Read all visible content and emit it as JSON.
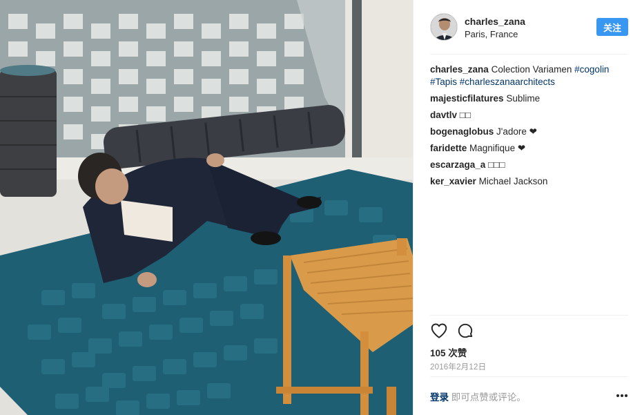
{
  "post": {
    "username": "charles_zana",
    "location": "Paris, France",
    "follow_label": "关注",
    "caption": {
      "user": "charles_zana",
      "text": "Colection Variamen",
      "tags": [
        "#cogolin",
        "#Tapis",
        "#charleszanaarchitects"
      ]
    },
    "comments": [
      {
        "user": "majesticfilatures",
        "text": "Sublime"
      },
      {
        "user": "davtlv",
        "text": "□□"
      },
      {
        "user": "bogenaglobus",
        "text": "J'adore ❤"
      },
      {
        "user": "faridette",
        "text": "Magnifique ❤"
      },
      {
        "user": "escarzaga_a",
        "text": "□□□"
      },
      {
        "user": "ker_xavier",
        "text": "Michael Jackson"
      }
    ],
    "likes": "105 次赞",
    "date": "2016年2月12日",
    "footer": {
      "login_label": "登录",
      "comment_hint": "即可点赞或评论。"
    },
    "icons": {
      "like": "heart-icon",
      "comment": "comment-bubble-icon",
      "more": "more-options-icon"
    }
  },
  "colors": {
    "accent": "#3897f0",
    "link": "#003569",
    "muted": "#999999"
  }
}
